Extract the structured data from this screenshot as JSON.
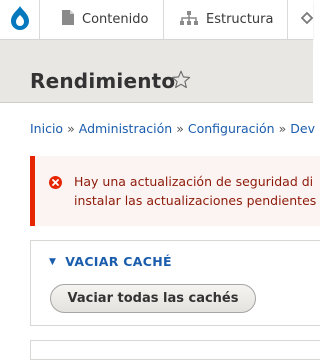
{
  "toolbar": {
    "logo_icon": "drupal-drop-icon",
    "items": [
      {
        "label": "Contenido",
        "icon": "file-icon"
      },
      {
        "label": "Estructura",
        "icon": "sitemap-icon"
      },
      {
        "label": "",
        "icon": "paintbrush-icon"
      }
    ]
  },
  "page": {
    "title": "Rendimiento",
    "favorite_icon": "star-outline-icon"
  },
  "breadcrumb": {
    "items": [
      "Inicio",
      "Administración",
      "Configuración",
      "Dev"
    ],
    "separator": "»"
  },
  "messages": {
    "error": {
      "icon": "error-x-icon",
      "line1": "Hay una actualización de seguridad di",
      "line2": "instalar las actualizaciones pendientes"
    }
  },
  "clear_cache": {
    "summary": "VACIAR CACHÉ",
    "button_label": "Vaciar todas las cachés"
  },
  "colors": {
    "link": "#1b5dad",
    "error_border": "#e62600",
    "error_text": "#8d1a09",
    "error_bg": "#fcf4f2",
    "header_bg": "#e8e7e4",
    "logo_blue": "#0678be"
  }
}
